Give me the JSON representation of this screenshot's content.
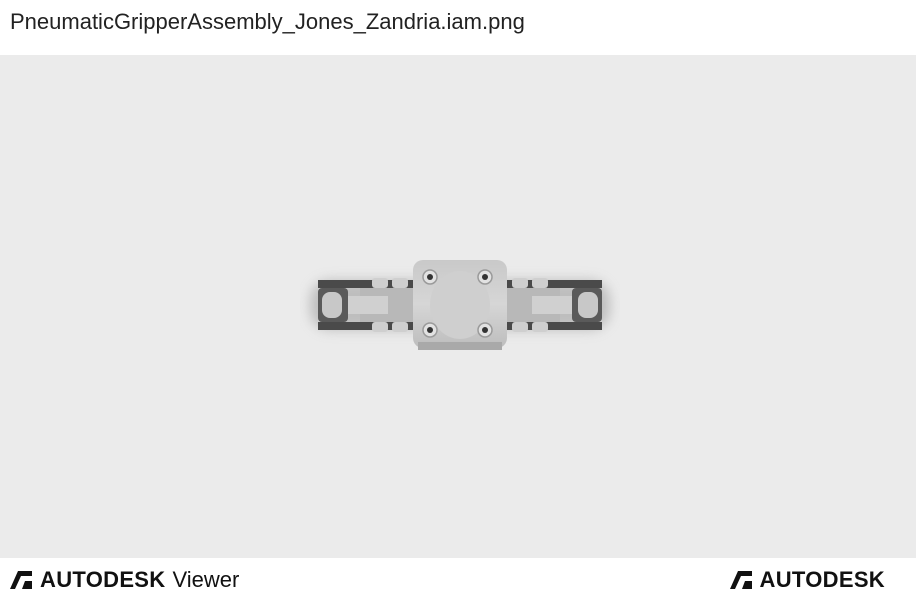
{
  "header": {
    "filename": "PneumaticGripperAssembly_Jones_Zandria.iam.png"
  },
  "viewport": {
    "model_name": "gripper-assembly-model",
    "background_color": "#ebebeb"
  },
  "footer": {
    "left_brand": "AUTODESK",
    "left_product": "Viewer",
    "right_brand": "AUTODESK"
  },
  "icons": {
    "autodesk_logo": "autodesk-logo-icon"
  }
}
